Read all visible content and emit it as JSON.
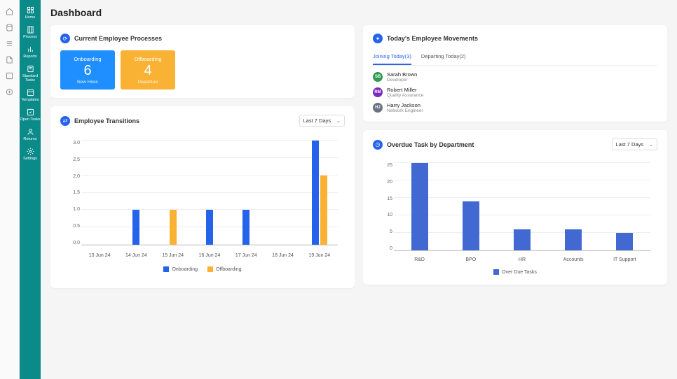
{
  "page_title": "Dashboard",
  "sidebar1": [
    {
      "icon": "home",
      "label": ""
    },
    {
      "icon": "db",
      "label": ""
    },
    {
      "icon": "list",
      "label": ""
    },
    {
      "icon": "doc",
      "label": ""
    },
    {
      "icon": "box",
      "label": ""
    },
    {
      "icon": "plus-circle",
      "label": ""
    }
  ],
  "sidebar2": [
    {
      "icon": "grid",
      "label": "Home"
    },
    {
      "icon": "building",
      "label": "Process"
    },
    {
      "icon": "bars",
      "label": "Reports"
    },
    {
      "icon": "checklist",
      "label": "Standard Tasks"
    },
    {
      "icon": "template",
      "label": "Templates"
    },
    {
      "icon": "tasks",
      "label": "Open Tasks"
    },
    {
      "icon": "user",
      "label": "Returns"
    },
    {
      "icon": "gear",
      "label": "Settings"
    }
  ],
  "processes_card": {
    "title": "Current Employee Processes",
    "onboarding": {
      "label": "Onboarding",
      "count": "6",
      "sub": "New Hires"
    },
    "offboarding": {
      "label": "Offboarding",
      "count": "4",
      "sub": "Departure"
    }
  },
  "movements_card": {
    "title": "Today's Employee Movements",
    "tabs": [
      {
        "label": "Joining Today(3)",
        "active": true
      },
      {
        "label": "Departing Today(2)",
        "active": false
      }
    ],
    "people": [
      {
        "initials": "SB",
        "color": "#2e9b4f",
        "name": "Sarah Brown",
        "role": "Developer"
      },
      {
        "initials": "RM",
        "color": "#7b2cbf",
        "name": "Robert Miller",
        "role": "Quality Assurance"
      },
      {
        "initials": "HJ",
        "color": "#6b7280",
        "name": "Harry Jackson",
        "role": "Network Engineer"
      }
    ]
  },
  "transitions_card": {
    "title": "Employee Transitions",
    "dropdown": "Last 7 Days"
  },
  "overdue_card": {
    "title": "Overdue Task by Department",
    "dropdown": "Last 7 Days"
  },
  "chart_data": [
    {
      "id": "transitions",
      "type": "bar",
      "categories": [
        "13 Jun 24",
        "14 Jun 24",
        "15 Jun 24",
        "16 Jun 24",
        "17 Jun 24",
        "18 Jun 24",
        "19 Jun 24"
      ],
      "series": [
        {
          "name": "Onboarding",
          "color": "#2563eb",
          "values": [
            0,
            1,
            0,
            1,
            1,
            0,
            3
          ]
        },
        {
          "name": "Offboarding",
          "color": "#f9b233",
          "values": [
            0,
            0,
            1,
            0,
            0,
            0,
            2
          ]
        }
      ],
      "ylim": [
        0,
        3
      ],
      "yticks": [
        0.0,
        0.5,
        1.0,
        1.5,
        2.0,
        2.5,
        3.0
      ],
      "legend": [
        "Onboarding",
        "Offboarding"
      ]
    },
    {
      "id": "overdue",
      "type": "bar",
      "categories": [
        "R&D",
        "BPO",
        "HR",
        "Accounts",
        "IT Support"
      ],
      "series": [
        {
          "name": "Over Due Tasks",
          "color": "#4169d1",
          "values": [
            25,
            14,
            6,
            6,
            5
          ]
        }
      ],
      "ylim": [
        0,
        25
      ],
      "yticks": [
        0,
        5,
        10,
        15,
        20,
        25
      ],
      "legend": [
        "Over Due Tasks"
      ]
    }
  ]
}
